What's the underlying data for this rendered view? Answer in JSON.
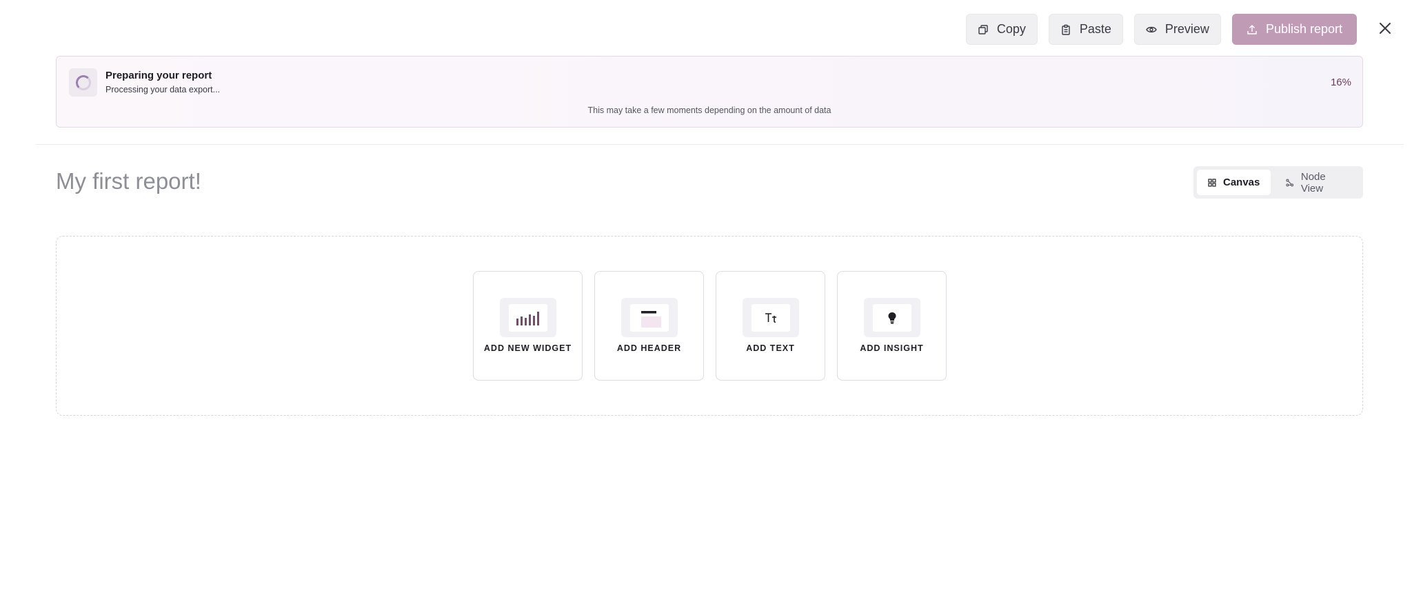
{
  "toolbar": {
    "copy_label": "Copy",
    "paste_label": "Paste",
    "preview_label": "Preview",
    "publish_label": "Publish report"
  },
  "progress": {
    "title": "Preparing your report",
    "subtitle": "Processing your data export...",
    "percent_label": "16%",
    "note": "This may take a few moments depending on the amount of data"
  },
  "report": {
    "title": "My first report!"
  },
  "view_toggle": {
    "canvas_label": "Canvas",
    "node_view_label": "Node View",
    "active": "Canvas"
  },
  "add_cards": [
    {
      "label": "ADD NEW WIDGET",
      "icon": "bar-chart-icon"
    },
    {
      "label": "ADD HEADER",
      "icon": "header-icon"
    },
    {
      "label": "ADD TEXT",
      "icon": "text-icon"
    },
    {
      "label": "ADD INSIGHT",
      "icon": "lightbulb-icon"
    }
  ],
  "colors": {
    "accent": "#c09bb5",
    "percent": "#6e3a5c",
    "chart_bars": "#7a4a6a"
  }
}
